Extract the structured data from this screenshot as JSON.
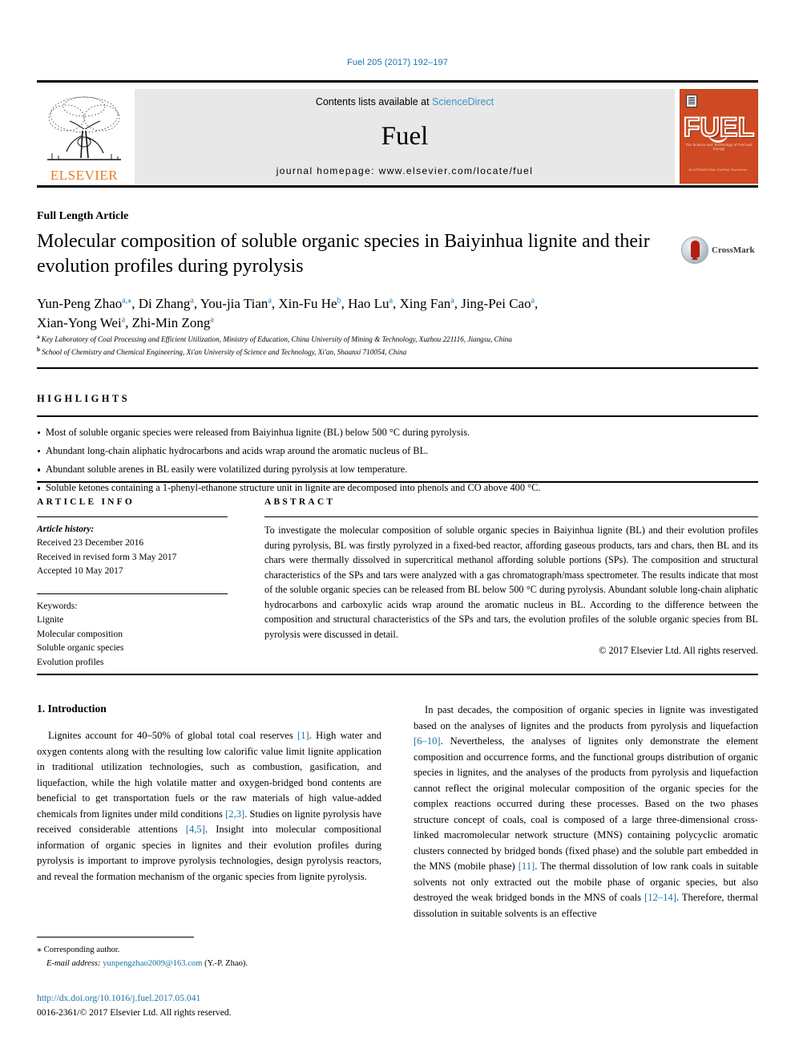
{
  "running_head": "Fuel 205 (2017) 192–197",
  "masthead": {
    "contents_prefix": "Contents lists available at ",
    "sciencedirect": "ScienceDirect",
    "journal_name": "Fuel",
    "homepage": "journal homepage: www.elsevier.com/locate/fuel",
    "publisher_logo_text": "ELSEVIER",
    "cover_title": "FUEL",
    "cover_subtitle": "The Science and Technology of Fuel and Energy",
    "cover_footer": "AN INTERNATIONAL JOURNAL\nElsevierFuel",
    "link_color": "#3c92c9",
    "cover_color": "#cf4a22"
  },
  "article": {
    "type": "Full Length Article",
    "title": "Molecular composition of soluble organic species in Baiyinhua lignite and their evolution profiles during pyrolysis",
    "crossmark_label": "CrossMark",
    "authors_line1": "Yun-Peng Zhao a,*, Di Zhang a, You-jia Tian a, Xin-Fu He b, Hao Lu a, Xing Fan a, Jing-Pei Cao a,",
    "authors_line2": "Xian-Yong Wei a, Zhi-Min Zong a",
    "authors": [
      {
        "name": "Yun-Peng Zhao",
        "sup": "a,⁎"
      },
      {
        "name": "Di Zhang",
        "sup": "a"
      },
      {
        "name": "You-jia Tian",
        "sup": "a"
      },
      {
        "name": "Xin-Fu He",
        "sup": "b"
      },
      {
        "name": "Hao Lu",
        "sup": "a"
      },
      {
        "name": "Xing Fan",
        "sup": "a"
      },
      {
        "name": "Jing-Pei Cao",
        "sup": "a"
      },
      {
        "name": "Xian-Yong Wei",
        "sup": "a"
      },
      {
        "name": "Zhi-Min Zong",
        "sup": "a"
      }
    ],
    "affiliations": [
      {
        "label": "a",
        "text": "Key Laboratory of Coal Processing and Efficient Utilization, Ministry of Education, China University of Mining & Technology, Xuzhou 221116, Jiangsu, China"
      },
      {
        "label": "b",
        "text": "School of Chemistry and Chemical Engineering, Xi'an University of Science and Technology, Xi'an, Shaanxi 710054, China"
      }
    ]
  },
  "highlights": {
    "heading": "HIGHLIGHTS",
    "items": [
      "Most of soluble organic species were released from Baiyinhua lignite (BL) below 500 °C during pyrolysis.",
      "Abundant long-chain aliphatic hydrocarbons and acids wrap around the aromatic nucleus of BL.",
      "Abundant soluble arenes in BL easily were volatilized during pyrolysis at low temperature.",
      "Soluble ketones containing a 1-phenyl-ethanone structure unit in lignite are decomposed into phenols and CO above 400 °C."
    ]
  },
  "article_info": {
    "heading": "ARTICLE INFO",
    "history_label": "Article history:",
    "history": [
      "Received 23 December 2016",
      "Received in revised form 3 May 2017",
      "Accepted 10 May 2017"
    ],
    "keywords_label": "Keywords:",
    "keywords": [
      "Lignite",
      "Molecular composition",
      "Soluble organic species",
      "Evolution profiles"
    ]
  },
  "abstract": {
    "heading": "ABSTRACT",
    "text": "To investigate the molecular composition of soluble organic species in Baiyinhua lignite (BL) and their evolution profiles during pyrolysis, BL was firstly pyrolyzed in a fixed-bed reactor, affording gaseous products, tars and chars, then BL and its chars were thermally dissolved in supercritical methanol affording soluble portions (SPs). The composition and structural characteristics of the SPs and tars were analyzed with a gas chromatograph/mass spectrometer. The results indicate that most of the soluble organic species can be released from BL below 500 °C during pyrolysis. Abundant soluble long-chain aliphatic hydrocarbons and carboxylic acids wrap around the aromatic nucleus in BL. According to the difference between the composition and structural characteristics of the SPs and tars, the evolution profiles of the soluble organic species from BL pyrolysis were discussed in detail.",
    "copyright": "© 2017 Elsevier Ltd. All rights reserved."
  },
  "body": {
    "section_title": "1. Introduction",
    "left_paragraph": "Lignites account for 40–50% of global total coal reserves [1]. High water and oxygen contents along with the resulting low calorific value limit lignite application in traditional utilization technologies, such as combustion, gasification, and liquefaction, while the high volatile matter and oxygen-bridged bond contents are beneficial to get transportation fuels or the raw materials of high value-added chemicals from lignites under mild conditions [2,3]. Studies on lignite pyrolysis have received considerable attentions [4,5]. Insight into molecular compositional information of organic species in lignites and their evolution profiles during pyrolysis is important to improve pyrolysis technologies, design pyrolysis reactors, and reveal the formation mechanism of the organic species from lignite pyrolysis.",
    "right_paragraph": "In past decades, the composition of organic species in lignite was investigated based on the analyses of lignites and the products from pyrolysis and liquefaction [6–10]. Nevertheless, the analyses of lignites only demonstrate the element composition and occurrence forms, and the functional groups distribution of organic species in lignites, and the analyses of the products from pyrolysis and liquefaction cannot reflect the original molecular composition of the organic species for the complex reactions occurred during these processes. Based on the two phases structure concept of coals, coal is composed of a large three-dimensional cross-linked macromolecular network structure (MNS) containing polycyclic aromatic clusters connected by bridged bonds (fixed phase) and the soluble part embedded in the MNS (mobile phase) [11]. The thermal dissolution of low rank coals in suitable solvents not only extracted out the mobile phase of organic species, but also destroyed the weak bridged bonds in the MNS of coals [12–14]. Therefore, thermal dissolution in suitable solvents is an effective"
  },
  "footer": {
    "corresponding_marker": "⁎",
    "corresponding_label": "Corresponding author.",
    "email_label": "E-mail address:",
    "email": "yunpengzhao2009@163.com",
    "email_suffix": "(Y.-P. Zhao).",
    "doi": "http://dx.doi.org/10.1016/j.fuel.2017.05.041",
    "issn": "0016-2361/© 2017 Elsevier Ltd. All rights reserved."
  }
}
